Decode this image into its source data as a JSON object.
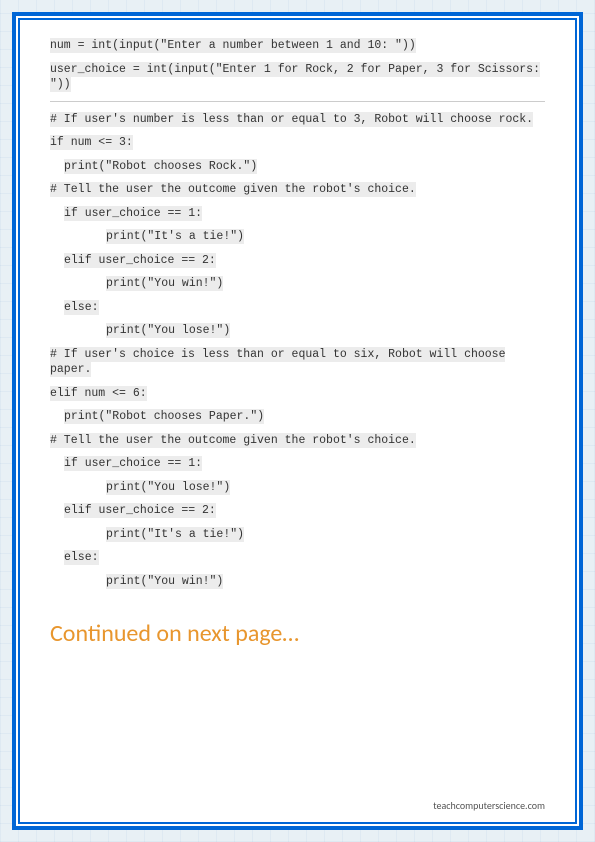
{
  "code": {
    "l1": "num = int(input(\"Enter a number between 1 and 10: \"))",
    "l2": "user_choice = int(input(\"Enter 1 for Rock, 2 for Paper, 3 for Scissors: \"))",
    "l3": "# If user's number is less than or equal to 3, Robot will choose rock.",
    "l4": "if num <= 3:",
    "l5": "print(\"Robot chooses Rock.\")",
    "l6": "# Tell the user the outcome given the robot's choice.",
    "l7": "if user_choice == 1:",
    "l8": "print(\"It's a tie!\")",
    "l9": "elif user_choice == 2:",
    "l10": "print(\"You win!\")",
    "l11": "else:",
    "l12": "print(\"You lose!\")",
    "l13": "# If user's choice is less than or equal to six, Robot will choose paper.",
    "l14": "elif num <= 6:",
    "l15": "print(\"Robot chooses Paper.\")",
    "l16": "# Tell the user the outcome given the robot's choice.",
    "l17": "if user_choice == 1:",
    "l18": "print(\"You lose!\")",
    "l19": "elif user_choice == 2:",
    "l20": "print(\"It's a tie!\")",
    "l21": "else:",
    "l22": "print(\"You win!\")"
  },
  "continued": "Continued on next page…",
  "footer": "teachcomputerscience.com"
}
